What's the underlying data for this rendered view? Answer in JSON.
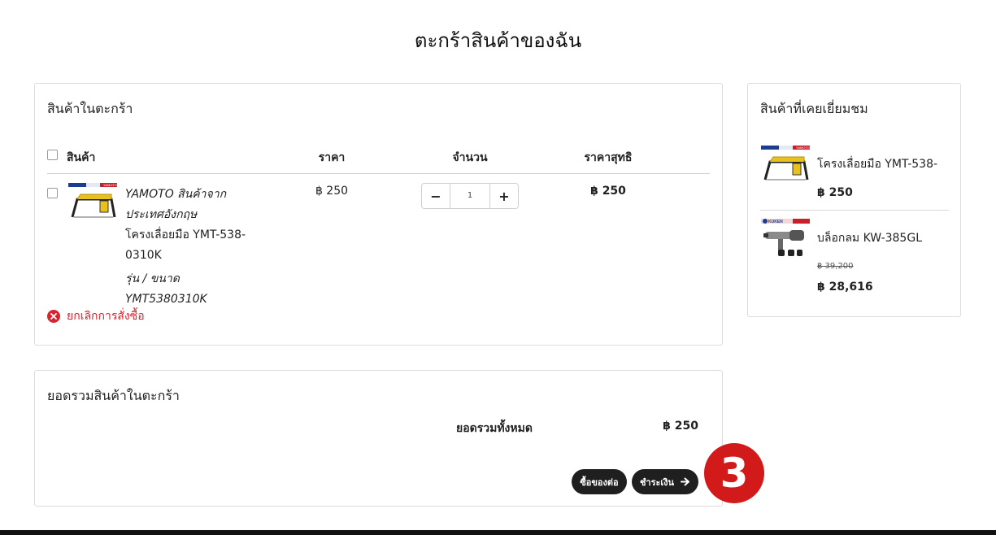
{
  "page": {
    "title": "ตะกร้าสินค้าของฉัน"
  },
  "cart": {
    "title": "สินค้าในตะกร้า",
    "headers": {
      "product": "สินค้า",
      "price": "ราคา",
      "quantity": "จำนวน",
      "total": "ราคาสุทธิ"
    },
    "items": [
      {
        "brand_note": "YAMOTO สินค้าจากประเทศอังกฤษ",
        "name": "โครงเลื่อยมือ YMT-538-0310K",
        "variant": "รุ่น / ขนาด YMT5380310K",
        "price": "฿ 250",
        "quantity": "1",
        "total": "฿ 250",
        "thumb_icon": "hacksaw-frame-image",
        "thumb_label": "YAMOTO"
      }
    ],
    "remove_label": "ยกเลิกการสั่งซื้อ",
    "minus_label": "−",
    "plus_label": "+"
  },
  "summary": {
    "title": "ยอดรวมสินค้าในตะกร้า",
    "total_label": "ยอดรวมทั้งหมด",
    "total_value": "฿ 250",
    "continue_label": "ซื้อของต่อ",
    "checkout_label": "ชำระเงิน"
  },
  "step_badge": "3",
  "recent": {
    "title": "สินค้าที่เคยเยี่ยมชม",
    "items": [
      {
        "name": "โครงเลื่อยมือ YMT-538-",
        "price": "฿ 250",
        "old_price": "",
        "thumb_icon": "hacksaw-frame-image",
        "thumb_label": "YAMOTO"
      },
      {
        "name": "บล็อกลม KW-385GL",
        "price": "฿ 28,616",
        "old_price": "฿ 39,200",
        "thumb_icon": "impact-wrench-image",
        "thumb_label": "KUKEN"
      }
    ]
  },
  "colors": {
    "accent_red": "#d9232d",
    "badge_red": "#d21a1a",
    "button_dark": "#1f1f1f"
  }
}
